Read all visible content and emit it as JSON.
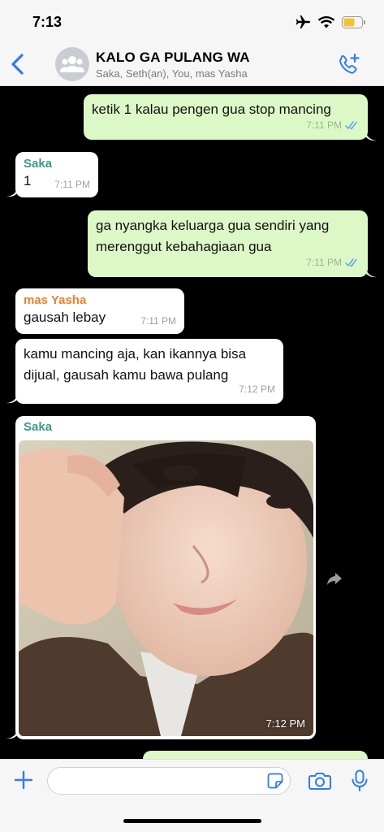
{
  "status": {
    "time": "7:13"
  },
  "header": {
    "title": "KALO GA PULANG WA",
    "subtitle": "Saka, Seth(an), You, mas Yasha"
  },
  "messages": [
    {
      "type": "outgoing",
      "text": "ketik 1 kalau pengen gua stop mancing",
      "time": "7:11 PM"
    },
    {
      "type": "incoming",
      "sender": "Saka",
      "text": "1",
      "time": "7:11 PM"
    },
    {
      "type": "outgoing",
      "text_line1": "ga nyangka keluarga gua sendiri yang",
      "text_line2": "merenggut kebahagiaan gua",
      "time": "7:11 PM"
    },
    {
      "type": "incoming",
      "sender": "mas Yasha",
      "text": "gausah lebay",
      "time": "7:11 PM"
    },
    {
      "type": "incoming",
      "text_line1": "kamu mancing aja, kan ikannya bisa",
      "text_line2": "dijual, gausah kamu bawa pulang",
      "time": "7:12 PM"
    },
    {
      "type": "incoming-photo",
      "sender": "Saka",
      "time": "7:12 PM"
    }
  ],
  "composer": {
    "placeholder": ""
  },
  "colors": {
    "outgoing_bubble": "#dcf8c6",
    "incoming_bubble": "#ffffff",
    "accent_blue": "#2f7bf5",
    "sender_teal": "#3a9a8c",
    "sender_orange": "#e8822d"
  }
}
